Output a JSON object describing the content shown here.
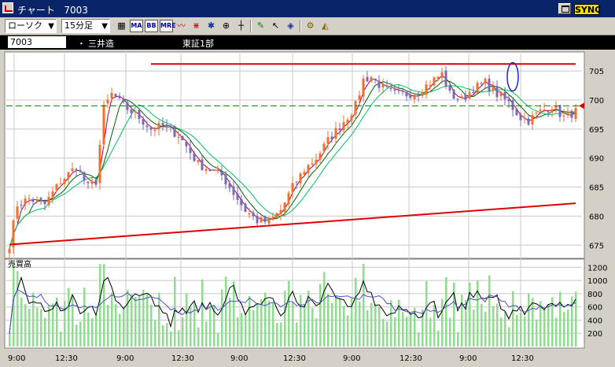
{
  "title_bar": {
    "title": "チャート   7003",
    "sync_label": "SYNC"
  },
  "toolbar": {
    "chart_type": "ローソク",
    "interval": "15分足",
    "tools": [
      {
        "name": "chart-settings-icon",
        "glyph": "▦"
      },
      {
        "name": "ma-indicator-button",
        "glyph": "MA",
        "boxed": true
      },
      {
        "name": "bb-indicator-button",
        "glyph": "BB",
        "boxed": true
      },
      {
        "name": "mre-indicator-button",
        "glyph": "MRE",
        "boxed": true
      },
      {
        "name": "line-chart-icon",
        "glyph": "〰",
        "color": "#c00000"
      },
      {
        "name": "cross-chart-icon",
        "glyph": "⋇",
        "color": "#c00000"
      },
      {
        "name": "star-icon",
        "glyph": "✱",
        "color": "#1030a0"
      },
      {
        "name": "globe-icon",
        "glyph": "⊕"
      },
      {
        "name": "crosshair-icon",
        "glyph": "┼"
      },
      {
        "name": "pencil-icon",
        "glyph": "✎",
        "color": "#008000"
      },
      {
        "name": "cursor-icon",
        "glyph": "↖"
      },
      {
        "name": "eraser-icon",
        "glyph": "◈",
        "color": "#1030a0"
      },
      {
        "name": "gear-icon",
        "glyph": "⚙",
        "color": "#806000"
      },
      {
        "name": "triangle-tool-icon",
        "glyph": "◭",
        "color": "#806000"
      }
    ]
  },
  "info_bar": {
    "code": "7003",
    "separator": "・",
    "name": "三井造",
    "market": "東証1部"
  },
  "colors": {
    "up": "#f07030",
    "down": "#7a6ab4",
    "ma_short": "#b00040",
    "ma_mid": "#006000",
    "ma_long": "#00c060",
    "trend": "#e00000",
    "ref_line": "#008000",
    "volume": "#8edc8e",
    "vol_ma1": "#000000",
    "vol_ma2": "#5050c0"
  },
  "chart_data": [
    {
      "type": "candlestick",
      "title": "",
      "ylim": [
        673,
        708
      ],
      "y_ticks": [
        "675",
        "680",
        "685",
        "690",
        "695",
        "700",
        "705"
      ],
      "x_tick_labels": [
        "9:00",
        "12:30",
        "9:00",
        "12:30",
        "9:00",
        "12:30",
        "9:00",
        "12:30",
        "9:00",
        "12:30"
      ],
      "session_segments": [
        {
          "start": "9:00",
          "anchors": [
            [
              0,
              675.2
            ],
            [
              2,
              682
            ],
            [
              5,
              683
            ],
            [
              9,
              682
            ],
            [
              13,
              686
            ],
            [
              17,
              688.5
            ],
            [
              20,
              685
            ],
            [
              22,
              686
            ],
            [
              24,
              698.5
            ],
            [
              26,
              701
            ],
            [
              29,
              699
            ],
            [
              33,
              697
            ],
            [
              36,
              695
            ],
            [
              39,
              695.5
            ],
            [
              43,
              694
            ]
          ]
        },
        {
          "start": "9:00",
          "anchors": [
            [
              0,
              693
            ],
            [
              4,
              689
            ],
            [
              7,
              688
            ],
            [
              10,
              687
            ],
            [
              13,
              684
            ],
            [
              16,
              681
            ],
            [
              19,
              679.2
            ],
            [
              22,
              679
            ],
            [
              25,
              681
            ],
            [
              28,
              685
            ],
            [
              31,
              688
            ],
            [
              34,
              690
            ],
            [
              37,
              693
            ],
            [
              40,
              695.5
            ],
            [
              43,
              698
            ]
          ]
        },
        {
          "start": "9:00",
          "anchors": [
            [
              0,
              699
            ],
            [
              2,
              703.5
            ],
            [
              4,
              704
            ],
            [
              7,
              702
            ],
            [
              10,
              701
            ],
            [
              13,
              701
            ],
            [
              16,
              701.5
            ],
            [
              19,
              703
            ],
            [
              22,
              704.5
            ],
            [
              24,
              701
            ],
            [
              27,
              700
            ],
            [
              30,
              702
            ],
            [
              33,
              703
            ],
            [
              36,
              701
            ],
            [
              39,
              699.5
            ],
            [
              42,
              697
            ],
            [
              44,
              696.5
            ],
            [
              47,
              698
            ],
            [
              50,
              699
            ],
            [
              53,
              697
            ],
            [
              56,
              698
            ]
          ]
        }
      ],
      "current_price": 699,
      "trend_lines": [
        {
          "from": [
            0,
            675.1
          ],
          "to": [
            150,
            682.2
          ]
        },
        {
          "from": [
            36,
            706.2
          ],
          "to": [
            150,
            706.2
          ]
        }
      ],
      "highlight_circle": {
        "x": 128,
        "y": 704
      }
    },
    {
      "type": "bar",
      "title": "売買高",
      "ylim": [
        0,
        1300
      ],
      "y_ticks": [
        "200",
        "400",
        "600",
        "800",
        "1000",
        "1200"
      ]
    }
  ]
}
